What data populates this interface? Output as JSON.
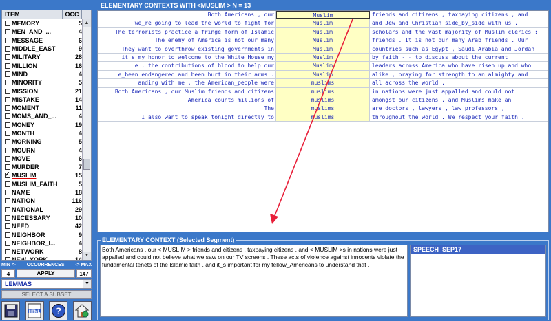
{
  "left": {
    "header": {
      "item": "ITEM",
      "occ": "OCC"
    },
    "items": [
      {
        "name": "MEMORY",
        "occ": "5"
      },
      {
        "name": "MEN_AND_...",
        "occ": "4"
      },
      {
        "name": "MESSAGE",
        "occ": "6"
      },
      {
        "name": "MIDDLE_EAST",
        "occ": "9"
      },
      {
        "name": "MILITARY",
        "occ": "28"
      },
      {
        "name": "MILLION",
        "occ": "16"
      },
      {
        "name": "MIND",
        "occ": "4"
      },
      {
        "name": "MINORITY",
        "occ": "5"
      },
      {
        "name": "MISSION",
        "occ": "21"
      },
      {
        "name": "MISTAKE",
        "occ": "14"
      },
      {
        "name": "MOMENT",
        "occ": "11"
      },
      {
        "name": "MOMS_AND_...",
        "occ": "4"
      },
      {
        "name": "MONEY",
        "occ": "19"
      },
      {
        "name": "MONTH",
        "occ": "4"
      },
      {
        "name": "MORNING",
        "occ": "5"
      },
      {
        "name": "MOURN",
        "occ": "4"
      },
      {
        "name": "MOVE",
        "occ": "6"
      },
      {
        "name": "MURDER",
        "occ": "7"
      },
      {
        "name": "MUSLIM",
        "occ": "15",
        "checked": true
      },
      {
        "name": "MUSLIM_FAITH",
        "occ": "5"
      },
      {
        "name": "NAME",
        "occ": "18"
      },
      {
        "name": "NATION",
        "occ": "116"
      },
      {
        "name": "NATIONAL",
        "occ": "29"
      },
      {
        "name": "NECESSARY",
        "occ": "10"
      },
      {
        "name": "NEED",
        "occ": "42"
      },
      {
        "name": "NEIGHBOR",
        "occ": "9"
      },
      {
        "name": "NEIGHBOR_I...",
        "occ": "4"
      },
      {
        "name": "NETWORK",
        "occ": "8"
      },
      {
        "name": "NEW_YORK",
        "occ": "14"
      }
    ],
    "occurrences": {
      "min_label": "MIN <-",
      "label": "OCCURRENCES",
      "max_label": "-> MAX",
      "min": "4",
      "apply": "APPLY",
      "max": "147"
    },
    "lemmas": "LEMMAS",
    "subset": "SELECT A SUBSET",
    "tools": [
      "save-icon",
      "html-icon",
      "help-icon",
      "home-icon"
    ],
    "html_label": "HTML"
  },
  "contexts": {
    "title": "ELEMENTARY CONTEXTS WITH  <MUSLIM > N =  13",
    "rows": [
      {
        "left": "Both Americans ,  our",
        "key": "Muslim",
        "right": "friends and citizens ,  taxpaying citizens ,  and"
      },
      {
        "left": "we_re going to lead the world to fight for",
        "key": "Muslim",
        "right": "and Jew and Christian side_by_side with us ."
      },
      {
        "left": "The terrorists practice a fringe form of Islamic",
        "key": "Muslim",
        "right": "scholars and the vast majority of Muslim clerics ;"
      },
      {
        "left": "The enemy of America is not our many",
        "key": "Muslim",
        "right": "friends .  It is not our many Arab friends .  Our"
      },
      {
        "left": "They want to overthrow existing governments in",
        "key": "Muslim",
        "right": "countries such_as Egypt ,  Saudi Arabia and Jordan"
      },
      {
        "left": "it_s my honor to welcome to the White_House my",
        "key": "Muslim",
        "right": "by faith  -  - to discuss about the current"
      },
      {
        "left": "e ,  the contributions of blood to help our",
        "key": "Muslim",
        "right": "leaders across America who have risen up and who"
      },
      {
        "left": "e_been endangered and been hurt in their arms .",
        "key": "Muslim",
        "right": "alike ,  praying for strength to an almighty and"
      },
      {
        "left": "anding with me ,  the American_people were",
        "key": "muslims",
        "right": "all across the world ."
      },
      {
        "left": "Both Americans ,  our Muslim friends and citizens",
        "key": "muslims",
        "right": "in nations were just appalled and could not"
      },
      {
        "left": "America counts millions of",
        "key": "muslims",
        "right": "amongst our citizens ,  and Muslims make an"
      },
      {
        "left": "The",
        "key": "muslims",
        "right": "are doctors ,  lawyers ,  law professors ,"
      },
      {
        "left": "I also want to speak tonight directly to",
        "key": "muslims",
        "right": "throughout the world .  We respect your faith ."
      }
    ]
  },
  "segment": {
    "title": "ELEMENTARY CONTEXT (Selected Segment)",
    "text": "Both Americans ,  our < MUSLIM > friends and citizens ,  taxpaying citizens ,  and < MUSLIM >s in nations were just appalled and could not believe what we saw on our TV screens .  These acts of violence against innocents violate the fundamental tenets of the Islamic faith ,  and it_s important for my fellow_Americans to understand that .",
    "source": "SPEECH_SEP17"
  },
  "colors": {
    "background": "#3b78c9",
    "keyword_cell": "#ffffc4",
    "context_text": "#1c2ab8",
    "arrow": "#e8203a"
  }
}
